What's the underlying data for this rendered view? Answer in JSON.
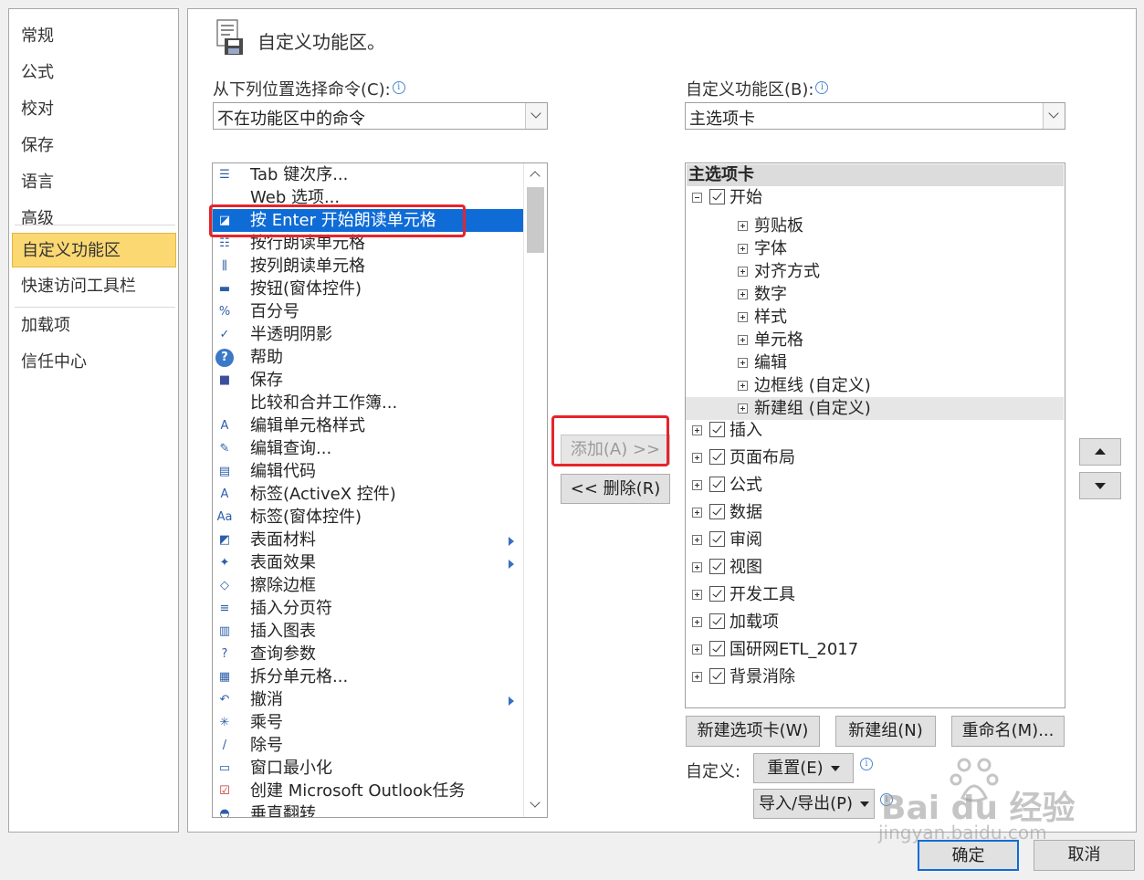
{
  "nav": {
    "items": [
      "常规",
      "公式",
      "校对",
      "保存",
      "语言",
      "高级",
      "自定义功能区",
      "快速访问工具栏",
      "加载项",
      "信任中心"
    ],
    "selected": "自定义功能区"
  },
  "header": {
    "title": "自定义功能区。"
  },
  "left": {
    "label": "从下列位置选择命令(C):",
    "combo_value": "不在功能区中的命令",
    "commands": [
      {
        "label": "Tab 键次序...",
        "icon": "tab-order-icon"
      },
      {
        "label": "Web 选项...",
        "icon": ""
      },
      {
        "label": "按 Enter 开始朗读单元格",
        "icon": "speak-enter-icon",
        "selected": true
      },
      {
        "label": "按行朗读单元格",
        "icon": "speak-rows-icon"
      },
      {
        "label": "按列朗读单元格",
        "icon": "speak-columns-icon"
      },
      {
        "label": "按钮(窗体控件)",
        "icon": "form-button-icon"
      },
      {
        "label": "百分号",
        "icon": "percent-icon"
      },
      {
        "label": "半透明阴影",
        "icon": "shadow-icon"
      },
      {
        "label": "帮助",
        "icon": "help-icon"
      },
      {
        "label": "保存",
        "icon": "save-icon"
      },
      {
        "label": "比较和合并工作簿...",
        "icon": ""
      },
      {
        "label": "编辑单元格样式",
        "icon": "cell-style-icon"
      },
      {
        "label": "编辑查询...",
        "icon": "edit-query-icon"
      },
      {
        "label": "编辑代码",
        "icon": "edit-code-icon"
      },
      {
        "label": "标签(ActiveX 控件)",
        "icon": "activex-label-icon"
      },
      {
        "label": "标签(窗体控件)",
        "icon": "form-label-icon"
      },
      {
        "label": "表面材料",
        "icon": "surface-material-icon",
        "submenu": true
      },
      {
        "label": "表面效果",
        "icon": "surface-effect-icon",
        "submenu": true
      },
      {
        "label": "擦除边框",
        "icon": "eraser-icon"
      },
      {
        "label": "插入分页符",
        "icon": "page-break-icon"
      },
      {
        "label": "插入图表",
        "icon": "insert-chart-icon"
      },
      {
        "label": "查询参数",
        "icon": "query-params-icon"
      },
      {
        "label": "拆分单元格...",
        "icon": "split-cells-icon"
      },
      {
        "label": "撤消",
        "icon": "undo-icon",
        "submenu": true
      },
      {
        "label": "乘号",
        "icon": "multiply-icon"
      },
      {
        "label": "除号",
        "icon": "divide-icon"
      },
      {
        "label": "窗口最小化",
        "icon": "minimize-icon"
      },
      {
        "label": "创建 Microsoft Outlook任务",
        "icon": "outlook-task-icon"
      },
      {
        "label": "垂直翻转",
        "icon": "flip-vertical-icon"
      }
    ]
  },
  "middle": {
    "add_label": "添加(A) >>",
    "remove_label": "<< 删除(R)"
  },
  "right": {
    "label": "自定义功能区(B):",
    "combo_value": "主选项卡",
    "tree_header": "主选项卡",
    "tabs": [
      {
        "label": "开始",
        "expanded": true,
        "groups": [
          "剪贴板",
          "字体",
          "对齐方式",
          "数字",
          "样式",
          "单元格",
          "编辑",
          "边框线 (自定义)",
          "新建组 (自定义)"
        ]
      },
      {
        "label": "插入"
      },
      {
        "label": "页面布局"
      },
      {
        "label": "公式"
      },
      {
        "label": "数据"
      },
      {
        "label": "审阅"
      },
      {
        "label": "视图"
      },
      {
        "label": "开发工具"
      },
      {
        "label": "加载项"
      },
      {
        "label": "国研网ETL_2017"
      },
      {
        "label": "背景消除"
      }
    ],
    "new_tab": "新建选项卡(W)",
    "new_group": "新建组(N)",
    "rename": "重命名(M)...",
    "custom_label": "自定义:",
    "reset": "重置(E)",
    "import_export": "导入/导出(P)"
  },
  "footer": {
    "ok": "确定",
    "cancel": "取消"
  },
  "watermark": {
    "brand": "Bai du 经验",
    "url": "jingyan.baidu.com"
  },
  "colors": {
    "accent": "#0f6cd6",
    "nav_selected": "#fbd872",
    "highlight": "#e8232b"
  }
}
